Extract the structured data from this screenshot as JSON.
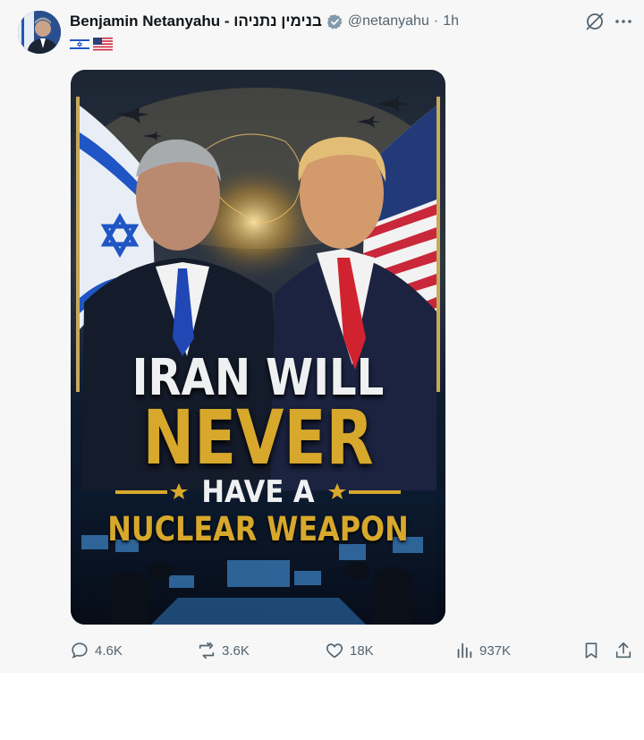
{
  "author": {
    "display_name": "Benjamin Netanyahu - בנימין נתניהו",
    "handle": "@netanyahu",
    "separator": "·",
    "time": "1h"
  },
  "flags": [
    "israel-flag-icon",
    "us-flag-icon"
  ],
  "top_icons": [
    "grok-icon",
    "more-icon"
  ],
  "media": {
    "poster_text": {
      "line1": "IRAN WILL",
      "line2": "NEVER",
      "line3": "HAVE A",
      "line4": "NUCLEAR WEAPON"
    },
    "colors": {
      "gold": "#d7a82c",
      "navy": "#0c1d33"
    }
  },
  "actions": {
    "replies": "4.6K",
    "reposts": "3.6K",
    "likes": "18K",
    "views": "937K"
  },
  "colors": {
    "text_primary": "#0f1419",
    "text_secondary": "#536471",
    "background": "#f7f7f7"
  }
}
